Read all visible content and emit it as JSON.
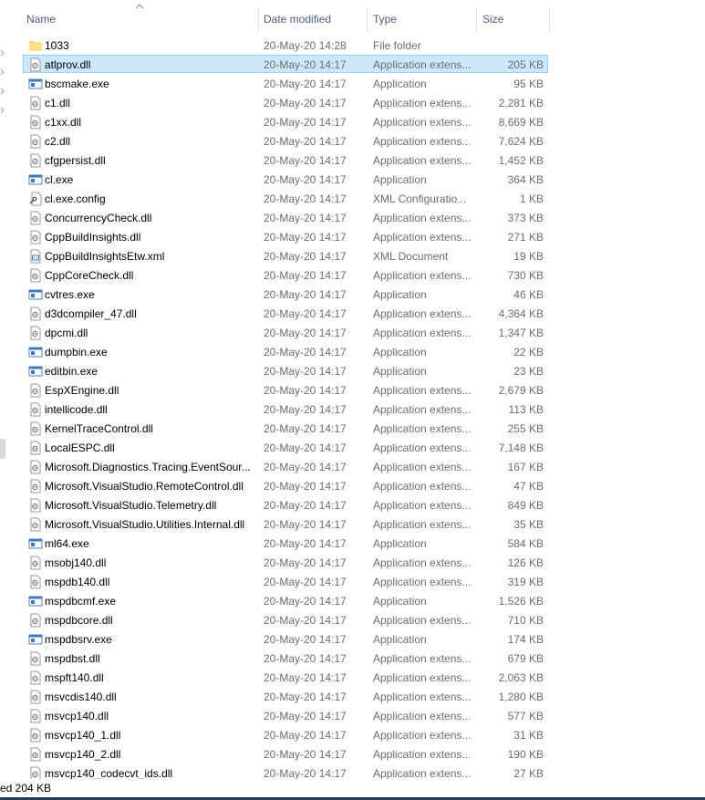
{
  "columns": {
    "name": "Name",
    "date_modified": "Date modified",
    "type": "Type",
    "size": "Size"
  },
  "files": [
    {
      "name": "1033",
      "date": "20-May-20 14:28",
      "type": "File folder",
      "size": "",
      "icon": "folder-icon"
    },
    {
      "name": "atlprov.dll",
      "date": "20-May-20 14:17",
      "type": "Application extens...",
      "size": "205 KB",
      "icon": "dll-file-icon",
      "selected": true
    },
    {
      "name": "bscmake.exe",
      "date": "20-May-20 14:17",
      "type": "Application",
      "size": "95 KB",
      "icon": "exe-file-icon"
    },
    {
      "name": "c1.dll",
      "date": "20-May-20 14:17",
      "type": "Application extens...",
      "size": "2,281 KB",
      "icon": "dll-file-icon"
    },
    {
      "name": "c1xx.dll",
      "date": "20-May-20 14:17",
      "type": "Application extens...",
      "size": "8,669 KB",
      "icon": "dll-file-icon"
    },
    {
      "name": "c2.dll",
      "date": "20-May-20 14:17",
      "type": "Application extens...",
      "size": "7,624 KB",
      "icon": "dll-file-icon"
    },
    {
      "name": "cfgpersist.dll",
      "date": "20-May-20 14:17",
      "type": "Application extens...",
      "size": "1,452 KB",
      "icon": "dll-file-icon"
    },
    {
      "name": "cl.exe",
      "date": "20-May-20 14:17",
      "type": "Application",
      "size": "364 KB",
      "icon": "exe-file-icon"
    },
    {
      "name": "cl.exe.config",
      "date": "20-May-20 14:17",
      "type": "XML Configuratio...",
      "size": "1 KB",
      "icon": "config-file-icon"
    },
    {
      "name": "ConcurrencyCheck.dll",
      "date": "20-May-20 14:17",
      "type": "Application extens...",
      "size": "373 KB",
      "icon": "dll-file-icon"
    },
    {
      "name": "CppBuildInsights.dll",
      "date": "20-May-20 14:17",
      "type": "Application extens...",
      "size": "271 KB",
      "icon": "dll-file-icon"
    },
    {
      "name": "CppBuildInsightsEtw.xml",
      "date": "20-May-20 14:17",
      "type": "XML Document",
      "size": "19 KB",
      "icon": "xml-file-icon"
    },
    {
      "name": "CppCoreCheck.dll",
      "date": "20-May-20 14:17",
      "type": "Application extens...",
      "size": "730 KB",
      "icon": "dll-file-icon"
    },
    {
      "name": "cvtres.exe",
      "date": "20-May-20 14:17",
      "type": "Application",
      "size": "46 KB",
      "icon": "exe-file-icon"
    },
    {
      "name": "d3dcompiler_47.dll",
      "date": "20-May-20 14:17",
      "type": "Application extens...",
      "size": "4,364 KB",
      "icon": "dll-file-icon"
    },
    {
      "name": "dpcmi.dll",
      "date": "20-May-20 14:17",
      "type": "Application extens...",
      "size": "1,347 KB",
      "icon": "dll-file-icon"
    },
    {
      "name": "dumpbin.exe",
      "date": "20-May-20 14:17",
      "type": "Application",
      "size": "22 KB",
      "icon": "exe-file-icon"
    },
    {
      "name": "editbin.exe",
      "date": "20-May-20 14:17",
      "type": "Application",
      "size": "23 KB",
      "icon": "exe-file-icon"
    },
    {
      "name": "EspXEngine.dll",
      "date": "20-May-20 14:17",
      "type": "Application extens...",
      "size": "2,679 KB",
      "icon": "dll-file-icon"
    },
    {
      "name": "intellicode.dll",
      "date": "20-May-20 14:17",
      "type": "Application extens...",
      "size": "113 KB",
      "icon": "dll-file-icon"
    },
    {
      "name": "KernelTraceControl.dll",
      "date": "20-May-20 14:17",
      "type": "Application extens...",
      "size": "255 KB",
      "icon": "dll-file-icon"
    },
    {
      "name": "LocalESPC.dll",
      "date": "20-May-20 14:17",
      "type": "Application extens...",
      "size": "7,148 KB",
      "icon": "dll-file-icon"
    },
    {
      "name": "Microsoft.Diagnostics.Tracing.EventSour...",
      "date": "20-May-20 14:17",
      "type": "Application extens...",
      "size": "167 KB",
      "icon": "dll-file-icon"
    },
    {
      "name": "Microsoft.VisualStudio.RemoteControl.dll",
      "date": "20-May-20 14:17",
      "type": "Application extens...",
      "size": "47 KB",
      "icon": "dll-file-icon"
    },
    {
      "name": "Microsoft.VisualStudio.Telemetry.dll",
      "date": "20-May-20 14:17",
      "type": "Application extens...",
      "size": "849 KB",
      "icon": "dll-file-icon"
    },
    {
      "name": "Microsoft.VisualStudio.Utilities.Internal.dll",
      "date": "20-May-20 14:17",
      "type": "Application extens...",
      "size": "35 KB",
      "icon": "dll-file-icon"
    },
    {
      "name": "ml64.exe",
      "date": "20-May-20 14:17",
      "type": "Application",
      "size": "584 KB",
      "icon": "exe-file-icon"
    },
    {
      "name": "msobj140.dll",
      "date": "20-May-20 14:17",
      "type": "Application extens...",
      "size": "126 KB",
      "icon": "dll-file-icon"
    },
    {
      "name": "mspdb140.dll",
      "date": "20-May-20 14:17",
      "type": "Application extens...",
      "size": "319 KB",
      "icon": "dll-file-icon"
    },
    {
      "name": "mspdbcmf.exe",
      "date": "20-May-20 14:17",
      "type": "Application",
      "size": "1,526 KB",
      "icon": "exe-file-icon"
    },
    {
      "name": "mspdbcore.dll",
      "date": "20-May-20 14:17",
      "type": "Application extens...",
      "size": "710 KB",
      "icon": "dll-file-icon"
    },
    {
      "name": "mspdbsrv.exe",
      "date": "20-May-20 14:17",
      "type": "Application",
      "size": "174 KB",
      "icon": "exe-file-icon"
    },
    {
      "name": "mspdbst.dll",
      "date": "20-May-20 14:17",
      "type": "Application extens...",
      "size": "679 KB",
      "icon": "dll-file-icon"
    },
    {
      "name": "mspft140.dll",
      "date": "20-May-20 14:17",
      "type": "Application extens...",
      "size": "2,063 KB",
      "icon": "dll-file-icon"
    },
    {
      "name": "msvcdis140.dll",
      "date": "20-May-20 14:17",
      "type": "Application extens...",
      "size": "1,280 KB",
      "icon": "dll-file-icon"
    },
    {
      "name": "msvcp140.dll",
      "date": "20-May-20 14:17",
      "type": "Application extens...",
      "size": "577 KB",
      "icon": "dll-file-icon"
    },
    {
      "name": "msvcp140_1.dll",
      "date": "20-May-20 14:17",
      "type": "Application extens...",
      "size": "31 KB",
      "icon": "dll-file-icon"
    },
    {
      "name": "msvcp140_2.dll",
      "date": "20-May-20 14:17",
      "type": "Application extens...",
      "size": "190 KB",
      "icon": "dll-file-icon"
    },
    {
      "name": "msvcp140_codecvt_ids.dll",
      "date": "20-May-20 14:17",
      "type": "Application extens...",
      "size": "27 KB",
      "icon": "dll-file-icon"
    }
  ],
  "status": {
    "text": "ed  204 KB"
  },
  "colors": {
    "selection_bg": "#cce8ff",
    "selection_border": "#99d1ff",
    "header_text": "#4c607a",
    "meta_text": "#6d6d6d"
  }
}
